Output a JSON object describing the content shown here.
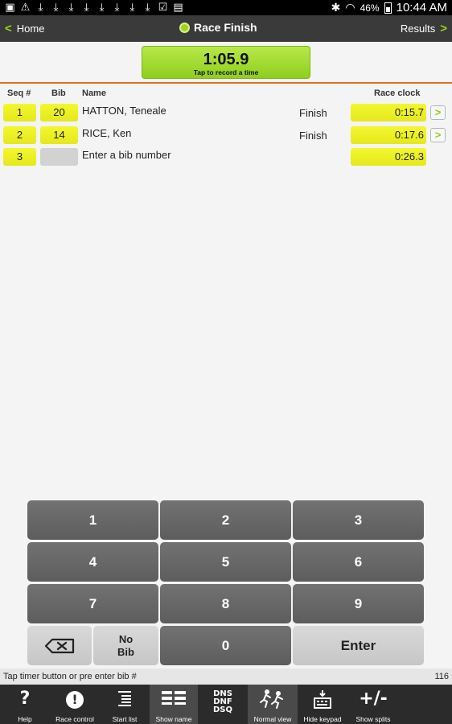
{
  "status_bar": {
    "battery_percent": "46%",
    "time": "10:44 AM",
    "notification_icons": [
      "image-icon",
      "warning-icon",
      "download-icon",
      "download-icon",
      "download-icon",
      "download-icon",
      "download-icon",
      "download-icon",
      "download-icon",
      "download-icon",
      "clipboard-check-icon",
      "shop-bag-icon"
    ]
  },
  "action_bar": {
    "back_label": "Home",
    "title": "Race Finish",
    "forward_label": "Results"
  },
  "timer": {
    "value": "1:05.9",
    "hint": "Tap to record a time"
  },
  "table": {
    "headers": {
      "seq": "Seq #",
      "bib": "Bib",
      "name": "Name",
      "race_clock": "Race clock"
    },
    "rows": [
      {
        "seq": "1",
        "bib": "20",
        "name": "HATTON, Teneale",
        "type": "Finish",
        "clock": "0:15.7"
      },
      {
        "seq": "2",
        "bib": "14",
        "name": "RICE, Ken",
        "type": "Finish",
        "clock": "0:17.6"
      },
      {
        "seq": "3",
        "bib": "",
        "name": "Enter a bib number",
        "type": "",
        "clock": "0:26.3"
      }
    ]
  },
  "keypad": {
    "k1": "1",
    "k2": "2",
    "k3": "3",
    "k4": "4",
    "k5": "5",
    "k6": "6",
    "k7": "7",
    "k8": "8",
    "k9": "9",
    "no_bib_line1": "No",
    "no_bib_line2": "Bib",
    "k0": "0",
    "enter": "Enter"
  },
  "status_line": {
    "message": "Tap timer button or pre enter bib #",
    "count": "116"
  },
  "toolbar": {
    "help": "Help",
    "race_control": "Race control",
    "start_list": "Start list",
    "show_name": "Show name",
    "dns_dnf_dsq_icon_text": [
      "DNS",
      "DNF",
      "DSQ"
    ],
    "normal_view": "Normal view",
    "hide_keypad": "Hide keypad",
    "show_splits": "Show splits",
    "show_splits_icon_text": "+/-",
    "help_icon_text": "?",
    "race_control_icon_text": "!"
  },
  "colors": {
    "accent_green": "#9fd31a",
    "highlight_yellow": "#eef02a",
    "divider_orange": "#e36a26",
    "bar_dark": "#3a3a3a"
  }
}
